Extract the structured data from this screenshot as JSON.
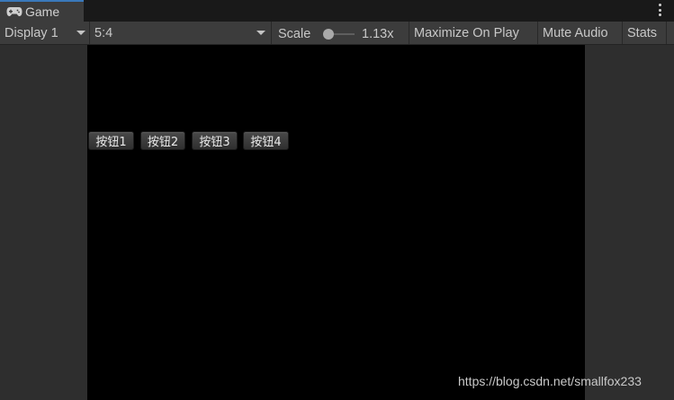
{
  "window": {
    "tab_label": "Game",
    "tab_icon": "gamepad-icon",
    "menu_icon": "kebab-menu-icon"
  },
  "toolbar": {
    "display": "Display 1",
    "aspect": "5:4",
    "scale_label": "Scale",
    "scale_value": "1.13x",
    "scale_fraction": 0.1,
    "maximize": "Maximize On Play",
    "mute": "Mute Audio",
    "stats": "Stats"
  },
  "game": {
    "buttons": [
      "按钮1",
      "按钮2",
      "按钮3",
      "按钮4"
    ],
    "background": "#000000"
  },
  "watermark": "https://blog.csdn.net/smallfox233",
  "colors": {
    "accent": "#3a79bb",
    "panel": "#3c3c3c",
    "background": "#282828"
  }
}
